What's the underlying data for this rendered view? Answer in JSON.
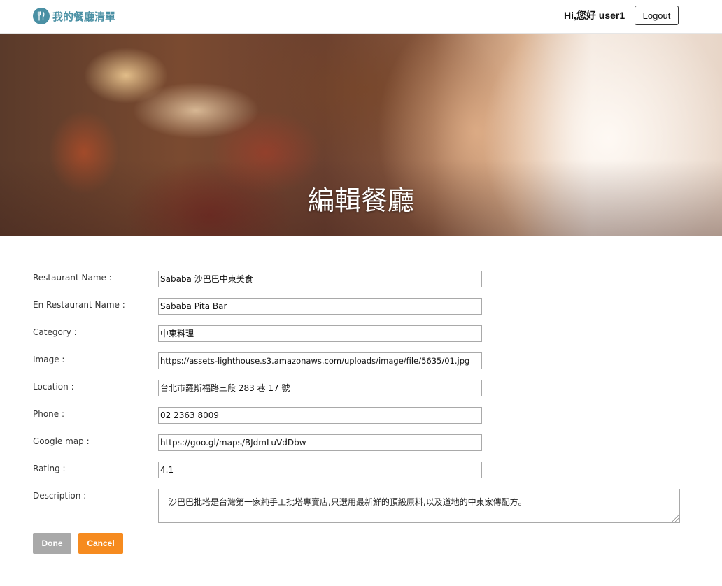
{
  "app": {
    "title": "我的餐廳清單"
  },
  "header": {
    "greeting": "Hi,您好  user1",
    "logout_label": "Logout"
  },
  "hero": {
    "title": "編輯餐廳"
  },
  "form": {
    "fields": [
      {
        "label": "Restaurant Name :",
        "value": "Sababa 沙巴巴中東美食"
      },
      {
        "label": "En Restaurant Name :",
        "value": "Sababa Pita Bar"
      },
      {
        "label": "Category :",
        "value": "中東料理"
      },
      {
        "label": "Image :",
        "value": "https://assets-lighthouse.s3.amazonaws.com/uploads/image/file/5635/01.jpg"
      },
      {
        "label": "Location :",
        "value": "台北市羅斯福路三段 283 巷 17 號"
      },
      {
        "label": "Phone :",
        "value": "02 2363 8009"
      },
      {
        "label": "Google map :",
        "value": "https://goo.gl/maps/BJdmLuVdDbw"
      },
      {
        "label": "Rating :",
        "value": "4.1"
      }
    ],
    "description": {
      "label": "Description :",
      "value": "沙巴巴批塔是台灣第一家純手工批塔專賣店,只選用最新鮮的頂級原料,以及道地的中東家傳配方。"
    },
    "done_label": "Done",
    "cancel_label": "Cancel"
  },
  "colors": {
    "brand": "#4a90a4",
    "cancel": "#f68b1f",
    "done": "#a9a9a9"
  },
  "icons": {
    "brand_logo": "utensils-icon",
    "resize": "resize-handle-icon"
  }
}
